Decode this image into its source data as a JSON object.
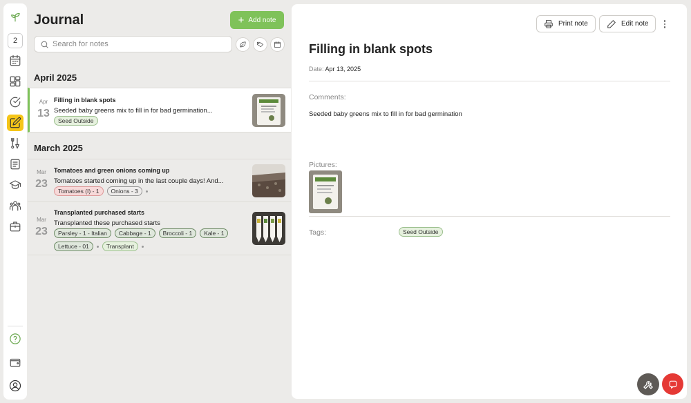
{
  "nav": {
    "badge": "2",
    "icons": [
      "sprout-logo-icon",
      "calendar-icon",
      "layout-grid-icon",
      "check-circle-icon",
      "note-edit-icon",
      "garden-tools-icon",
      "document-icon",
      "graduation-cap-icon",
      "community-icon",
      "briefcase-icon",
      "help-circle-icon",
      "wallet-icon",
      "avatar-icon"
    ],
    "active": "note-edit-icon",
    "accent": "#f5c518"
  },
  "list": {
    "title": "Journal",
    "add_label": "Add note",
    "search_placeholder": "Search for notes",
    "filter_icons": [
      "leaf-icon",
      "tag-icon",
      "calendar-icon"
    ],
    "groups": [
      {
        "month": "April 2025",
        "entries": [
          {
            "mon": "Apr",
            "day": "13",
            "title": "Filling in blank spots",
            "desc": "Seeded baby greens mix to fill in for bad germination...",
            "tags": [
              {
                "label": "Seed Outside",
                "style": "green"
              }
            ],
            "selected": true
          }
        ]
      },
      {
        "month": "March 2025",
        "entries": [
          {
            "mon": "Mar",
            "day": "23",
            "title": "Tomatoes and green onions coming up",
            "desc": "Tomatoes started coming up in the last couple days! And...",
            "tags": [
              {
                "label": "Tomatoes (I) - 1",
                "style": "red"
              },
              {
                "label": "Onions - 3",
                "style": "gray"
              }
            ],
            "selected": false
          },
          {
            "mon": "Mar",
            "day": "23",
            "title": "Transplanted purchased starts",
            "desc": "Transplanted these purchased starts",
            "tags": [
              {
                "label": "Parsley - 1 - Italian",
                "style": "dk"
              },
              {
                "label": "Cabbage - 1",
                "style": "dk"
              },
              {
                "label": "Broccoli - 1",
                "style": "dk"
              },
              {
                "label": "Kale - 1",
                "style": "dk"
              },
              {
                "label": "Lettuce - 01",
                "style": "dk"
              },
              {
                "label": "Transplant",
                "style": "green"
              }
            ],
            "selected": false
          }
        ]
      }
    ],
    "accent": "#7fc25a"
  },
  "detail": {
    "print_label": "Print note",
    "edit_label": "Edit note",
    "title": "Filling in blank spots",
    "date_label": "Date:",
    "date_value": "Apr 13, 2025",
    "comments_label": "Comments:",
    "comments_text": "Seeded baby greens mix to fill in for bad germination",
    "pictures_label": "Pictures:",
    "tags_label": "Tags:",
    "tag": "Seed Outside"
  }
}
